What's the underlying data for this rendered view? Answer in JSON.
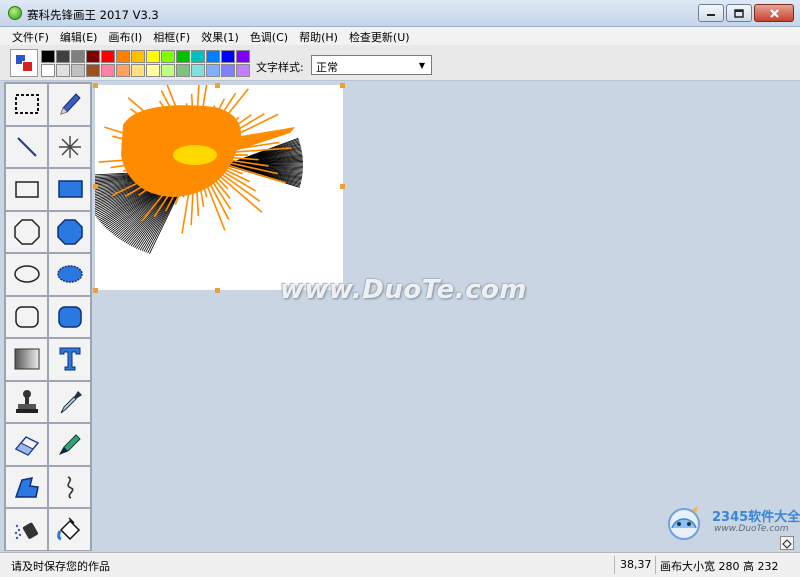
{
  "window": {
    "title": "赛科先锋画王 2017 V3.3",
    "controls": [
      "minimize",
      "maximize",
      "close"
    ]
  },
  "menu": [
    {
      "label": "文件(F)"
    },
    {
      "label": "编辑(E)"
    },
    {
      "label": "画布(I)"
    },
    {
      "label": "相框(F)"
    },
    {
      "label": "效果(1)"
    },
    {
      "label": "色调(C)"
    },
    {
      "label": "帮助(H)"
    },
    {
      "label": "检查更新(U)"
    }
  ],
  "toolbar": {
    "current_colors": {
      "foreground": "#2a56c6",
      "background": "#d42020"
    },
    "palette": [
      "#000000",
      "#404040",
      "#808080",
      "#800000",
      "#ff0000",
      "#ff8000",
      "#ffc000",
      "#ffff00",
      "#80ff00",
      "#00c000",
      "#00c0c0",
      "#0080ff",
      "#0000ff",
      "#8000ff",
      "#ffffff",
      "#e0e0e0",
      "#c0c0c0",
      "#a05020",
      "#ff80a0",
      "#ffa060",
      "#ffe080",
      "#ffffa0",
      "#c0ff80",
      "#80c080",
      "#80e0e0",
      "#80b0ff",
      "#8080ff",
      "#c080ff"
    ],
    "font_style_label": "文字样式:",
    "font_style_value": "正常"
  },
  "tools": [
    {
      "name": "select-rect-tool",
      "icon": "dashed-rect-icon"
    },
    {
      "name": "pencil-tool",
      "icon": "pencil-icon"
    },
    {
      "name": "line-tool",
      "icon": "line-icon"
    },
    {
      "name": "starburst-tool",
      "icon": "starburst-icon"
    },
    {
      "name": "rectangle-tool",
      "icon": "rectangle-outline-icon"
    },
    {
      "name": "filled-rectangle-tool",
      "icon": "rectangle-filled-icon"
    },
    {
      "name": "octagon-tool",
      "icon": "octagon-outline-icon"
    },
    {
      "name": "filled-octagon-tool",
      "icon": "octagon-filled-icon"
    },
    {
      "name": "ellipse-tool",
      "icon": "ellipse-outline-icon"
    },
    {
      "name": "filled-ellipse-tool",
      "icon": "ellipse-filled-icon"
    },
    {
      "name": "rounded-rect-tool",
      "icon": "rounded-rect-outline-icon"
    },
    {
      "name": "filled-rounded-rect-tool",
      "icon": "rounded-rect-filled-icon"
    },
    {
      "name": "gradient-tool",
      "icon": "gradient-icon"
    },
    {
      "name": "text-tool",
      "icon": "text-t-icon"
    },
    {
      "name": "stamp-tool",
      "icon": "stamp-icon"
    },
    {
      "name": "eyedropper-tool",
      "icon": "eyedropper-icon"
    },
    {
      "name": "eraser-tool",
      "icon": "eraser-icon"
    },
    {
      "name": "marker-tool",
      "icon": "marker-icon"
    },
    {
      "name": "polygon-tool",
      "icon": "polygon-icon"
    },
    {
      "name": "curve-tool",
      "icon": "curve-icon"
    },
    {
      "name": "spray-tool",
      "icon": "spray-icon"
    },
    {
      "name": "fill-bucket-tool",
      "icon": "paint-bucket-icon"
    }
  ],
  "canvas": {
    "background": "#ffffff",
    "drawing_colors": {
      "orange": "#ff8c00",
      "yellow": "#ffd800",
      "black": "#000000"
    }
  },
  "watermark": {
    "text": "www.DuoTe.com",
    "brand": "2345软件大全",
    "url": "www.DuoTe.com"
  },
  "status": {
    "message": "请及时保存您的作品",
    "position": "38,37",
    "canvas_size": "画布大小宽 280 高 232"
  }
}
